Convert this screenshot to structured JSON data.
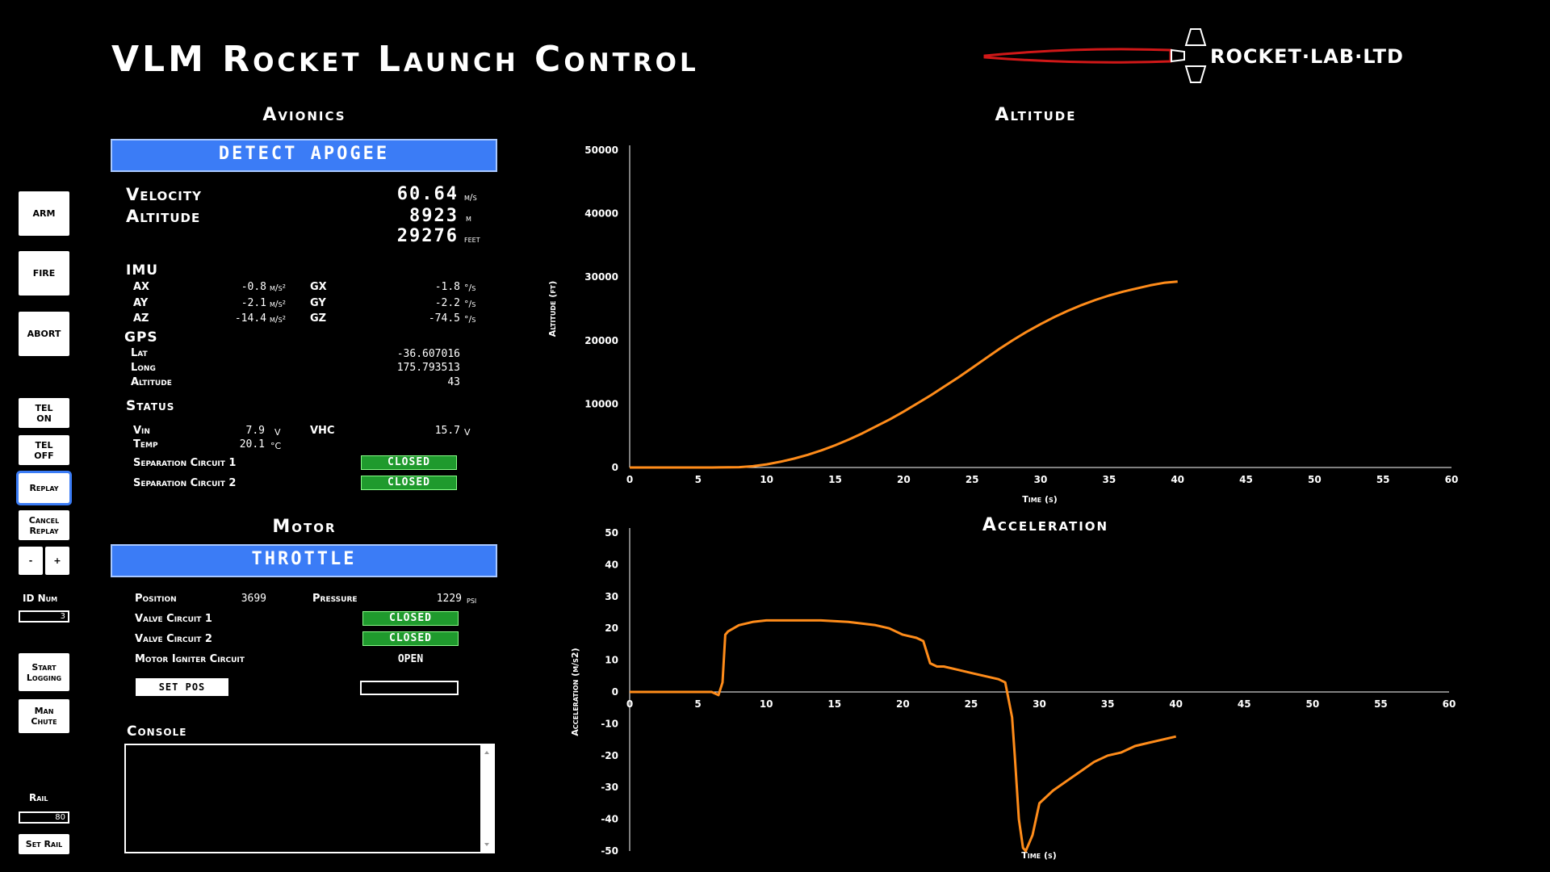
{
  "title": "VLM Rocket Launch Control",
  "brand": {
    "logo_text": "ROCKET·LAB·LTD"
  },
  "sidebar": {
    "arm": "ARM",
    "fire": "FIRE",
    "abort": "ABORT",
    "tel_on": "TEL\nON",
    "tel_off": "TEL\nOFF",
    "replay": "Replay",
    "cancel_replay": "Cancel\nReplay",
    "minus": "-",
    "plus": "+",
    "id_num_label": "ID Num",
    "id_num_value": "3",
    "start_logging": "Start\nLogging",
    "man_chute": "Man\nChute",
    "rail_label": "Rail",
    "rail_value": "80",
    "set_rail": "Set Rail"
  },
  "avionics": {
    "title": "Avionics",
    "banner": "DETECT APOGEE",
    "velocity_label": "Velocity",
    "velocity_value": "60.64",
    "velocity_unit": "m/s",
    "altitude_label": "Altitude",
    "altitude_m": "8923",
    "altitude_m_unit": "m",
    "altitude_ft": "29276",
    "altitude_ft_unit": "feet",
    "imu": {
      "label": "IMU",
      "ax_label": "AX",
      "ax": "-0.8",
      "ax_unit": "m/s²",
      "ay_label": "AY",
      "ay": "-2.1",
      "ay_unit": "m/s²",
      "az_label": "AZ",
      "az": "-14.4",
      "az_unit": "m/s²",
      "gx_label": "GX",
      "gx": "-1.8",
      "gx_unit": "°/s",
      "gy_label": "GY",
      "gy": "-2.2",
      "gy_unit": "°/s",
      "gz_label": "GZ",
      "gz": "-74.5",
      "gz_unit": "°/s"
    },
    "gps": {
      "label": "GPS",
      "lat_label": "Lat",
      "lat": "-36.607016",
      "long_label": "Long",
      "long": "175.793513",
      "alt_label": "Altitude",
      "alt": "43"
    },
    "status": {
      "label": "Status",
      "vin_label": "Vin",
      "vin": "7.9",
      "vin_unit": "V",
      "vhc_label": "VHC",
      "vhc": "15.7",
      "vhc_unit": "V",
      "temp_label": "Temp",
      "temp": "20.1",
      "temp_unit": "°C",
      "sep1_label": "Separation Circuit 1",
      "sep1": "CLOSED",
      "sep2_label": "Separation Circuit 2",
      "sep2": "CLOSED"
    }
  },
  "motor": {
    "title": "Motor",
    "banner": "THROTTLE",
    "position_label": "Position",
    "position": "3699",
    "pressure_label": "Pressure",
    "pressure": "1229",
    "pressure_unit": "psi",
    "valve1_label": "Valve Circuit 1",
    "valve1": "CLOSED",
    "valve2_label": "Valve Circuit 2",
    "valve2": "CLOSED",
    "igniter_label": "Motor Igniter Circuit",
    "igniter": "OPEN",
    "set_pos": "SET POS",
    "pos_input": ""
  },
  "console": {
    "label": "Console"
  },
  "colors": {
    "accent_blue": "#3b7cf6",
    "status_green": "#1f9a2d",
    "trace_orange": "#ff8c1a",
    "logo_red": "#d01818"
  },
  "chart_data": [
    {
      "type": "line",
      "title": "Altitude",
      "xlabel": "Time (s)",
      "ylabel": "Altitude (ft)",
      "xlim": [
        0,
        60
      ],
      "ylim": [
        0,
        50000
      ],
      "xticks": [
        0,
        5,
        10,
        15,
        20,
        25,
        30,
        35,
        40,
        45,
        50,
        55,
        60
      ],
      "yticks": [
        0,
        10000,
        20000,
        30000,
        40000,
        50000
      ],
      "series": [
        {
          "x": [
            0,
            2,
            4,
            6,
            8,
            9,
            10,
            11,
            12,
            13,
            14,
            15,
            16,
            17,
            18,
            19,
            20,
            21,
            22,
            23,
            24,
            25,
            26,
            27,
            28,
            29,
            30,
            31,
            32,
            33,
            34,
            35,
            36,
            37,
            38,
            39,
            40
          ],
          "y": [
            0,
            0,
            0,
            0,
            50,
            200,
            500,
            900,
            1400,
            2000,
            2700,
            3500,
            4400,
            5400,
            6500,
            7600,
            8800,
            10100,
            11400,
            12800,
            14200,
            15700,
            17200,
            18700,
            20100,
            21400,
            22600,
            23700,
            24700,
            25600,
            26400,
            27100,
            27700,
            28200,
            28700,
            29100,
            29300
          ]
        }
      ]
    },
    {
      "type": "line",
      "title": "Acceleration",
      "xlabel": "Time (s)",
      "ylabel": "Acceleration (m/s2)",
      "xlim": [
        0,
        60
      ],
      "ylim": [
        -50,
        50
      ],
      "xticks": [
        0,
        5,
        10,
        15,
        20,
        25,
        30,
        35,
        40,
        45,
        50,
        55,
        60
      ],
      "yticks": [
        -50,
        -40,
        -30,
        -20,
        -10,
        0,
        10,
        20,
        30,
        40,
        50
      ],
      "series": [
        {
          "x": [
            0,
            3,
            6,
            6.5,
            6.8,
            7,
            7.2,
            8,
            9,
            10,
            12,
            14,
            16,
            18,
            19,
            20,
            21,
            21.5,
            22,
            22.5,
            23,
            24,
            25,
            26,
            27,
            27.5,
            28,
            28.2,
            28.5,
            28.8,
            29,
            29.5,
            30,
            31,
            32,
            33,
            34,
            35,
            36,
            37,
            38,
            39,
            40
          ],
          "y": [
            0,
            0,
            0,
            -1,
            3,
            18,
            19,
            21,
            22,
            22.5,
            22.5,
            22.5,
            22,
            21,
            20,
            18,
            17,
            16,
            9,
            8,
            8,
            7,
            6,
            5,
            4,
            3,
            -8,
            -20,
            -40,
            -49,
            -50,
            -45,
            -35,
            -31,
            -28,
            -25,
            -22,
            -20,
            -19,
            -17,
            -16,
            -15,
            -14
          ]
        }
      ]
    }
  ]
}
